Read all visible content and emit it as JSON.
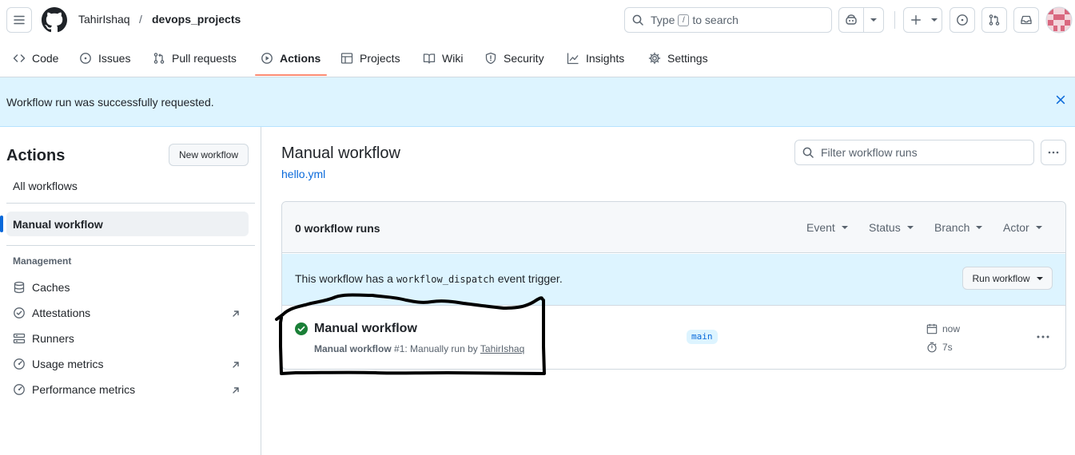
{
  "header": {
    "owner": "TahirIshaq",
    "separator": "/",
    "repo": "devops_projects",
    "search": {
      "prefix": "Type",
      "key": "/",
      "suffix": "to search"
    }
  },
  "repo_nav": {
    "tabs": [
      {
        "label": "Code",
        "icon": "code-icon"
      },
      {
        "label": "Issues",
        "icon": "issue-icon"
      },
      {
        "label": "Pull requests",
        "icon": "pull-request-icon"
      },
      {
        "label": "Actions",
        "icon": "play-icon",
        "selected": true
      },
      {
        "label": "Projects",
        "icon": "table-icon"
      },
      {
        "label": "Wiki",
        "icon": "book-icon"
      },
      {
        "label": "Security",
        "icon": "shield-icon"
      },
      {
        "label": "Insights",
        "icon": "graph-icon"
      },
      {
        "label": "Settings",
        "icon": "gear-icon"
      }
    ]
  },
  "flash": {
    "message": "Workflow run was successfully requested."
  },
  "sidebar": {
    "title": "Actions",
    "new_workflow_label": "New workflow",
    "all_workflows_label": "All workflows",
    "active_workflow_label": "Manual workflow",
    "management_heading": "Management",
    "management_items": [
      {
        "label": "Caches",
        "icon": "database-icon",
        "external": false
      },
      {
        "label": "Attestations",
        "icon": "verified-icon",
        "external": true
      },
      {
        "label": "Runners",
        "icon": "server-icon",
        "external": false
      },
      {
        "label": "Usage metrics",
        "icon": "meter-icon",
        "external": true
      },
      {
        "label": "Performance metrics",
        "icon": "meter-icon",
        "external": true
      }
    ]
  },
  "main": {
    "title": "Manual workflow",
    "file_link": "hello.yml",
    "filter_placeholder": "Filter workflow runs",
    "runs_count_label": "0 workflow runs",
    "filters": [
      "Event",
      "Status",
      "Branch",
      "Actor"
    ],
    "dispatch": {
      "before": "This workflow has a",
      "code": "workflow_dispatch",
      "after": "event trigger.",
      "run_button_label": "Run workflow"
    },
    "run": {
      "title": "Manual workflow",
      "workflow_name": "Manual workflow",
      "run_info": "#1: Manually run by",
      "actor": "TahirIshaq",
      "branch": "main",
      "time": "now",
      "duration": "7s",
      "status": "success",
      "status_color": "#1a7f37"
    }
  },
  "colors": {
    "accent": "#0969da",
    "underline": "#fd8c73",
    "flash_bg": "#ddf4ff",
    "success": "#1a7f37"
  }
}
